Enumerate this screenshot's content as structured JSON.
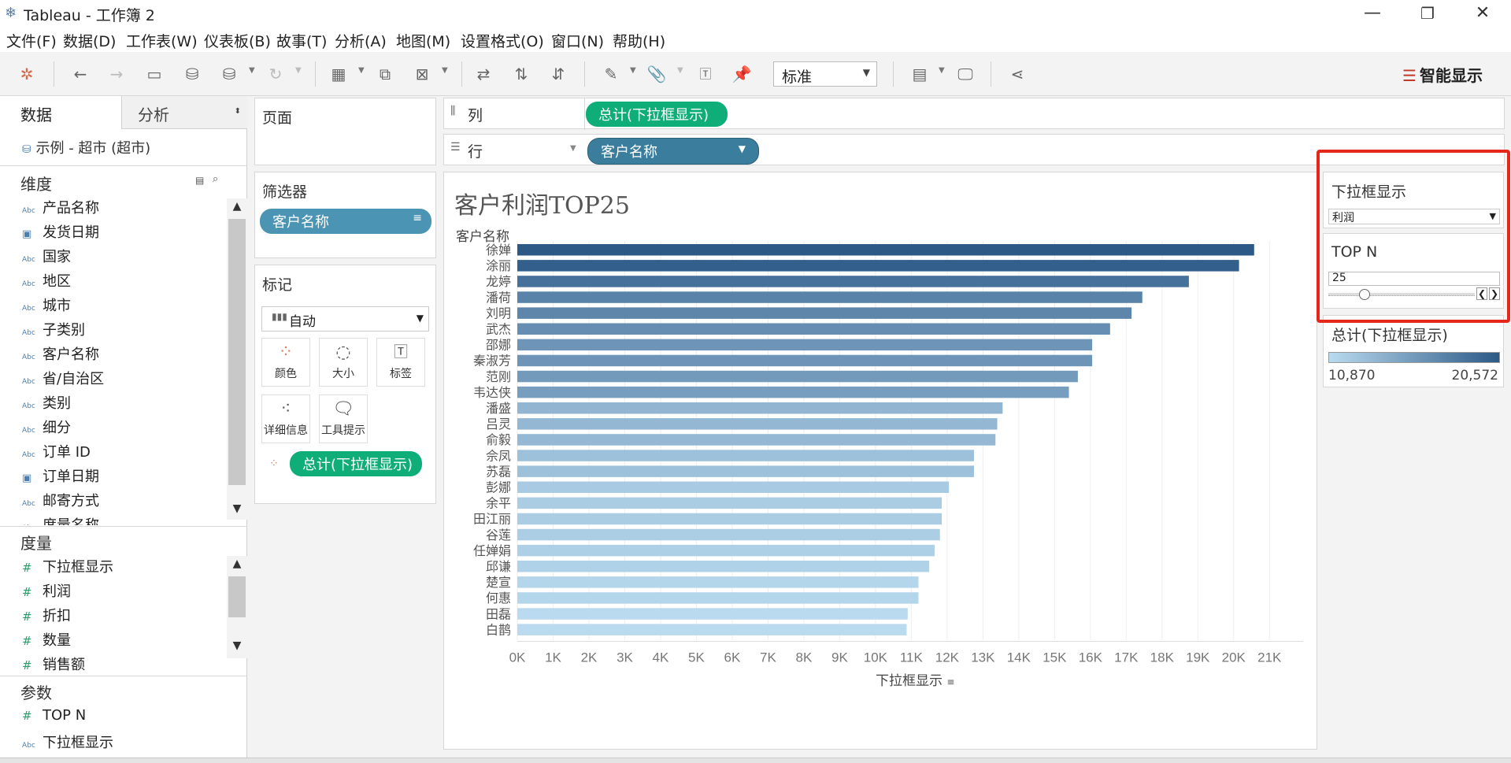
{
  "window": {
    "title": "Tableau - 工作簿 2",
    "minimize": "—",
    "restore": "❐",
    "close": "✕"
  },
  "menu": [
    "文件(F)",
    "数据(D)",
    "工作表(W)",
    "仪表板(B)",
    "故事(T)",
    "分析(A)",
    "地图(M)",
    "设置格式(O)",
    "窗口(N)",
    "帮助(H)"
  ],
  "toolbar": {
    "fit": "标准",
    "smart_show": "智能显示"
  },
  "data_pane": {
    "tab_data": "数据",
    "tab_analysis": "分析",
    "datasource": "示例 - 超市 (超市)",
    "dimensions_title": "维度",
    "dimensions": [
      {
        "name": "产品名称",
        "type": "Abc"
      },
      {
        "name": "发货日期",
        "type": "date"
      },
      {
        "name": "国家",
        "type": "Abc"
      },
      {
        "name": "地区",
        "type": "Abc"
      },
      {
        "name": "城市",
        "type": "Abc"
      },
      {
        "name": "子类别",
        "type": "Abc"
      },
      {
        "name": "客户名称",
        "type": "Abc"
      },
      {
        "name": "省/自治区",
        "type": "Abc"
      },
      {
        "name": "类别",
        "type": "Abc"
      },
      {
        "name": "细分",
        "type": "Abc"
      },
      {
        "name": "订单 ID",
        "type": "Abc"
      },
      {
        "name": "订单日期",
        "type": "date"
      },
      {
        "name": "邮寄方式",
        "type": "Abc"
      },
      {
        "name": "度量名称",
        "type": "Abc"
      }
    ],
    "measures_title": "度量",
    "measures": [
      {
        "name": "下拉框显示",
        "type": "#"
      },
      {
        "name": "利润",
        "type": "#"
      },
      {
        "name": "折扣",
        "type": "#"
      },
      {
        "name": "数量",
        "type": "#"
      },
      {
        "name": "销售额",
        "type": "#"
      }
    ],
    "params_title": "参数",
    "params": [
      {
        "name": "TOP N",
        "type": "#"
      },
      {
        "name": "下拉框显示",
        "type": "Abc"
      }
    ]
  },
  "shelves": {
    "pages_title": "页面",
    "filters_title": "筛选器",
    "filter_pill": "客户名称",
    "marks_title": "标记",
    "mark_type": "自动",
    "mark_buttons": [
      "颜色",
      "大小",
      "标签",
      "详细信息",
      "工具提示"
    ],
    "mark_pill": "总计(下拉框显示)",
    "columns_label": "列",
    "columns_pill": "总计(下拉框显示)",
    "rows_label": "行",
    "rows_pill": "客户名称"
  },
  "controls": {
    "dropdown_title": "下拉框显示",
    "dropdown_value": "利润",
    "topn_title": "TOP N",
    "topn_value": "25",
    "legend_title": "总计(下拉框显示)",
    "legend_min": "10,870",
    "legend_max": "20,572"
  },
  "chart_data": {
    "type": "bar",
    "orientation": "horizontal",
    "title": "客户利润TOP25",
    "ylabel": "客户名称",
    "xlabel": "下拉框显示",
    "categories": [
      "徐婵",
      "涂丽",
      "龙婷",
      "潘荷",
      "刘明",
      "武杰",
      "邵娜",
      "秦淑芳",
      "范刚",
      "韦达侠",
      "潘盛",
      "吕灵",
      "俞毅",
      "佘凤",
      "苏磊",
      "彭娜",
      "余平",
      "田江丽",
      "谷莲",
      "任婵娟",
      "邱谦",
      "楚宣",
      "何惠",
      "田磊",
      "白鹊"
    ],
    "values": [
      20572,
      20150,
      18750,
      17450,
      17150,
      16550,
      16050,
      16050,
      15650,
      15400,
      13550,
      13400,
      13350,
      12750,
      12750,
      12050,
      11850,
      11850,
      11800,
      11650,
      11500,
      11200,
      11200,
      10900,
      10870
    ],
    "x_ticks": [
      "0K",
      "1K",
      "2K",
      "3K",
      "4K",
      "5K",
      "6K",
      "7K",
      "8K",
      "9K",
      "10K",
      "11K",
      "12K",
      "13K",
      "14K",
      "15K",
      "16K",
      "17K",
      "18K",
      "19K",
      "20K",
      "21K"
    ],
    "xlim": [
      0,
      21500
    ],
    "color_range": [
      "#b9daef",
      "#2c5986"
    ],
    "grid": true
  }
}
